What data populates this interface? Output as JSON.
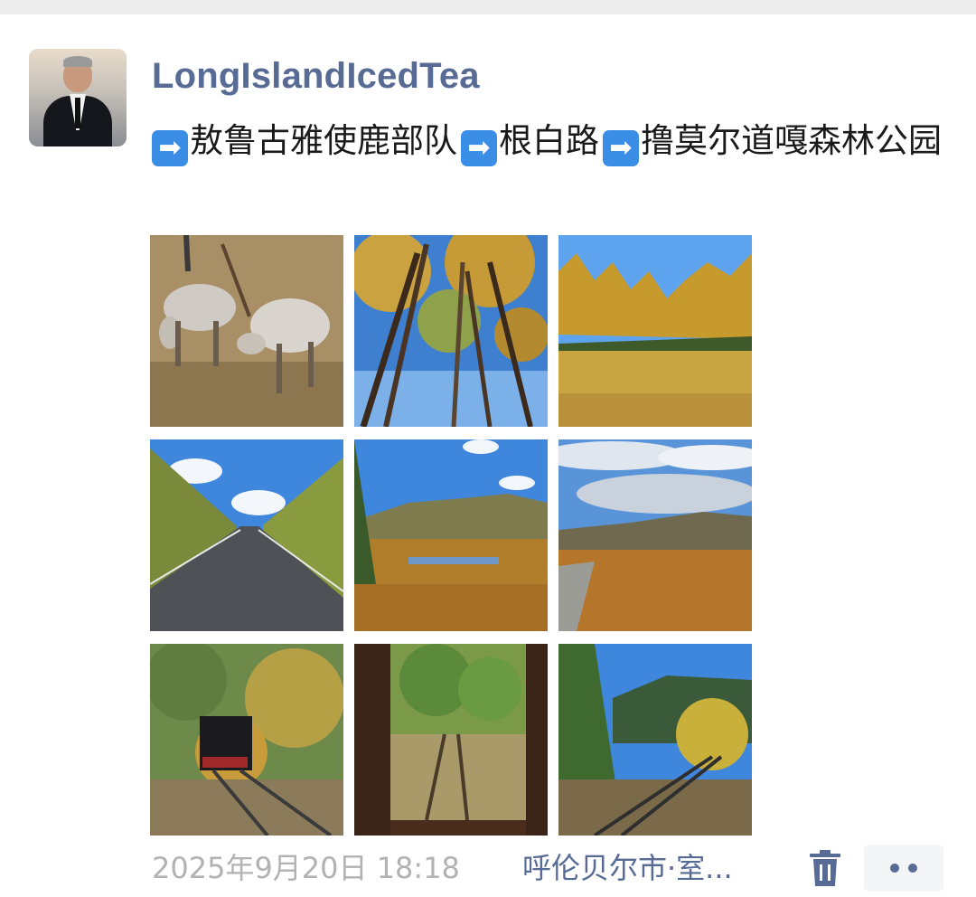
{
  "post": {
    "username": "LongIslandIcedTea",
    "route": [
      {
        "arrow_icon": "arrow-right-icon",
        "arrow": "➡",
        "text": "敖鲁古雅使鹿部队"
      },
      {
        "arrow_icon": "arrow-right-icon",
        "arrow": "➡",
        "text": "根白路"
      },
      {
        "arrow_icon": "arrow-right-icon",
        "arrow": "➡",
        "text": "撸莫尔道嘎森林公园"
      }
    ],
    "photos": [
      {
        "subject": "reindeer"
      },
      {
        "subject": "tall-trees-sky"
      },
      {
        "subject": "golden-meadow"
      },
      {
        "subject": "forest-road"
      },
      {
        "subject": "autumn-river-valley"
      },
      {
        "subject": "cloudy-field"
      },
      {
        "subject": "steam-train"
      },
      {
        "subject": "railway-view-from-window"
      },
      {
        "subject": "railway-track-forest"
      }
    ],
    "timestamp": "2025年9月20日 18:18",
    "location": "呼伦贝尔市·室...",
    "delete_icon": "trash-icon",
    "more_icon": "more-dots-icon"
  },
  "colors": {
    "username": "#576b95",
    "link": "#576b95",
    "meta": "#b2b2b2",
    "arrow_badge": "#3b8ee6"
  }
}
